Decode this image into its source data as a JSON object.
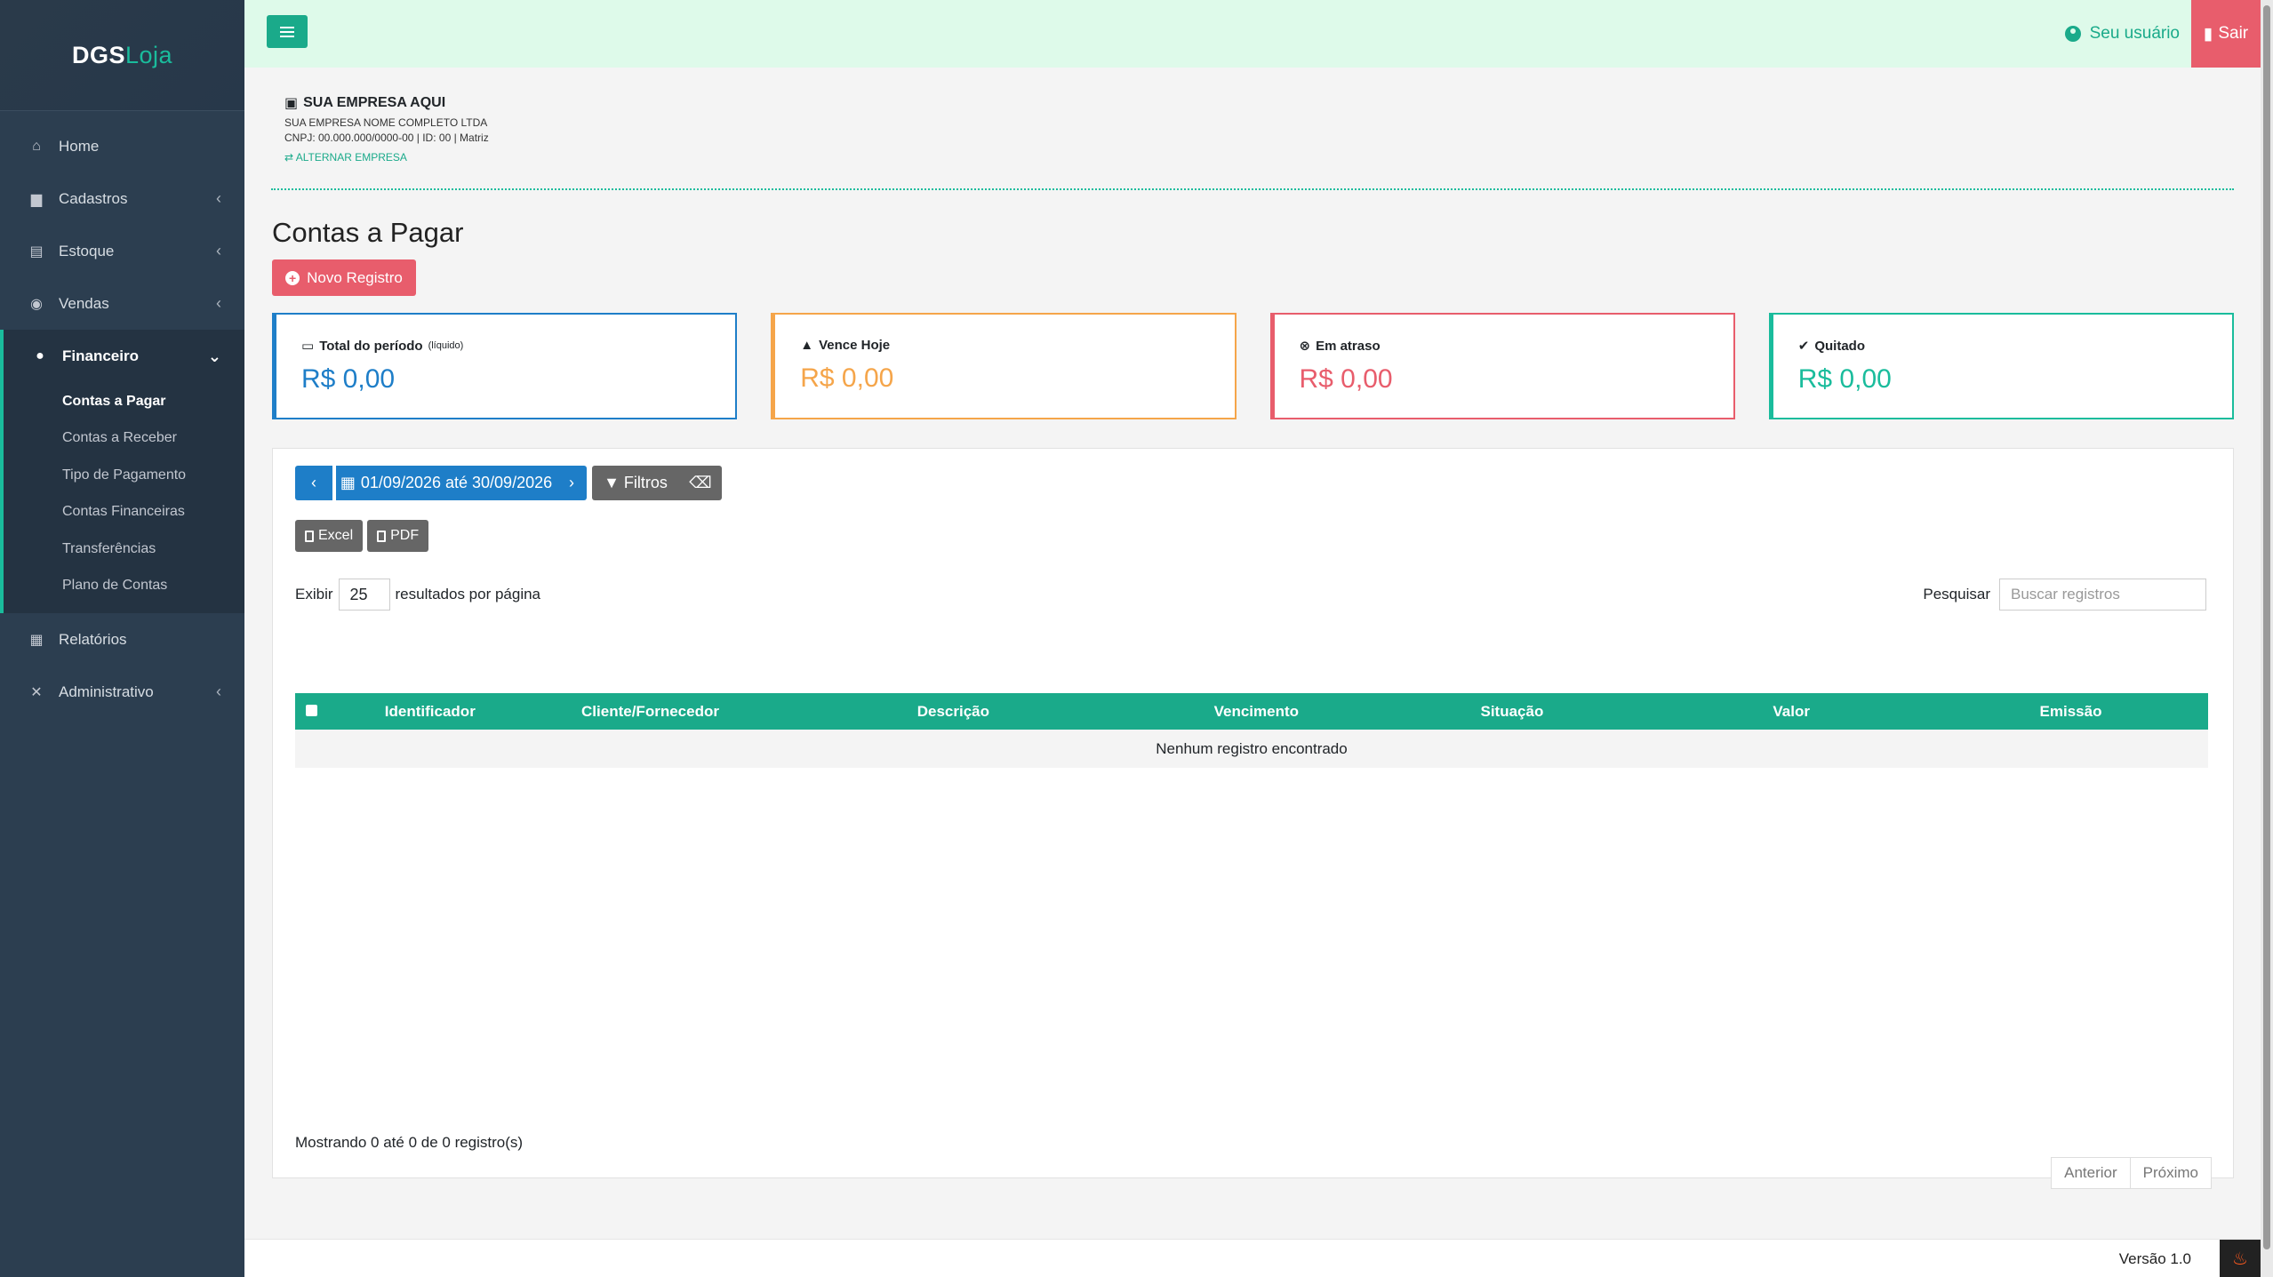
{
  "brand": {
    "part1": "DGS",
    "part2": "Loja"
  },
  "sidebar": {
    "items": [
      {
        "label": "Home"
      },
      {
        "label": "Cadastros"
      },
      {
        "label": "Estoque"
      },
      {
        "label": "Vendas"
      },
      {
        "label": "Financeiro"
      },
      {
        "label": "Relatórios"
      },
      {
        "label": "Administrativo"
      }
    ],
    "financeiro_sub": [
      {
        "label": "Contas a Pagar"
      },
      {
        "label": "Contas a Receber"
      },
      {
        "label": "Tipo de Pagamento"
      },
      {
        "label": "Contas Financeiras"
      },
      {
        "label": "Transferências"
      },
      {
        "label": "Plano de Contas"
      }
    ]
  },
  "topbar": {
    "user_label": "Seu usuário",
    "logout_label": "Sair"
  },
  "company": {
    "name": "SUA EMPRESA AQUI",
    "full_name": "SUA EMPRESA NOME COMPLETO LTDA",
    "details": "CNPJ: 00.000.000/0000-00 | ID: 00 | Matriz",
    "switch_label": "ALTERNAR EMPRESA"
  },
  "page": {
    "title": "Contas a Pagar",
    "new_button": "Novo Registro"
  },
  "cards": [
    {
      "title": "Total do período",
      "note": "(líquido)",
      "value": "R$ 0,00"
    },
    {
      "title": "Vence Hoje",
      "value": "R$ 0,00"
    },
    {
      "title": "Em atraso",
      "value": "R$ 0,00"
    },
    {
      "title": "Quitado",
      "value": "R$ 0,00"
    }
  ],
  "filters": {
    "date_range": "01/09/2026 até 30/09/2026",
    "filters_label": "Filtros"
  },
  "export": {
    "excel": "Excel",
    "pdf": "PDF"
  },
  "table": {
    "length_prefix": "Exibir",
    "length_value": "25",
    "length_suffix": "resultados por página",
    "search_label": "Pesquisar",
    "search_placeholder": "Buscar registros",
    "columns": [
      "Identificador",
      "Cliente/Fornecedor",
      "Descrição",
      "Vencimento",
      "Situação",
      "Valor",
      "Emissão"
    ],
    "empty_message": "Nenhum registro encontrado",
    "info": "Mostrando 0 até 0 de 0 registro(s)",
    "prev": "Anterior",
    "next": "Próximo"
  },
  "footer": {
    "version": "Versão 1.0"
  },
  "colors": {
    "sidebar": "#2c3e50",
    "accent": "#1abc9c",
    "danger": "#e85d6c",
    "primary": "#1e7ec8",
    "warning": "#f5a54a"
  }
}
